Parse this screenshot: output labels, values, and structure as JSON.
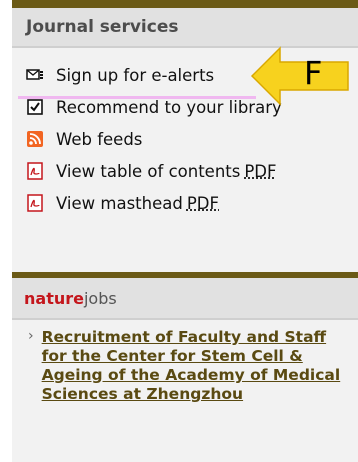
{
  "journal_services": {
    "title": "Journal services",
    "items": [
      {
        "label": "Sign up for e-alerts",
        "icon": "email-alert-icon"
      },
      {
        "label": "Recommend to your library",
        "icon": "checkbox-icon"
      },
      {
        "label": "Web feeds",
        "icon": "rss-icon"
      },
      {
        "label": "View table of contents",
        "suffix": "PDF",
        "icon": "pdf-icon"
      },
      {
        "label": "View masthead",
        "suffix": "PDF",
        "icon": "pdf-icon"
      }
    ]
  },
  "annotation": {
    "letter": "F",
    "arrow_color": "#f7d21e"
  },
  "naturejobs": {
    "brand_nature": "nature",
    "brand_jobs": "jobs",
    "job_title": "Recruitment of Faculty and Staff for the Center for Stem Cell & Ageing of the Academy of Medical Sciences at Zhengzhou"
  },
  "colors": {
    "accent_bar": "#6b5a16",
    "brand_red": "#c4161c",
    "link": "#5a4a12"
  }
}
